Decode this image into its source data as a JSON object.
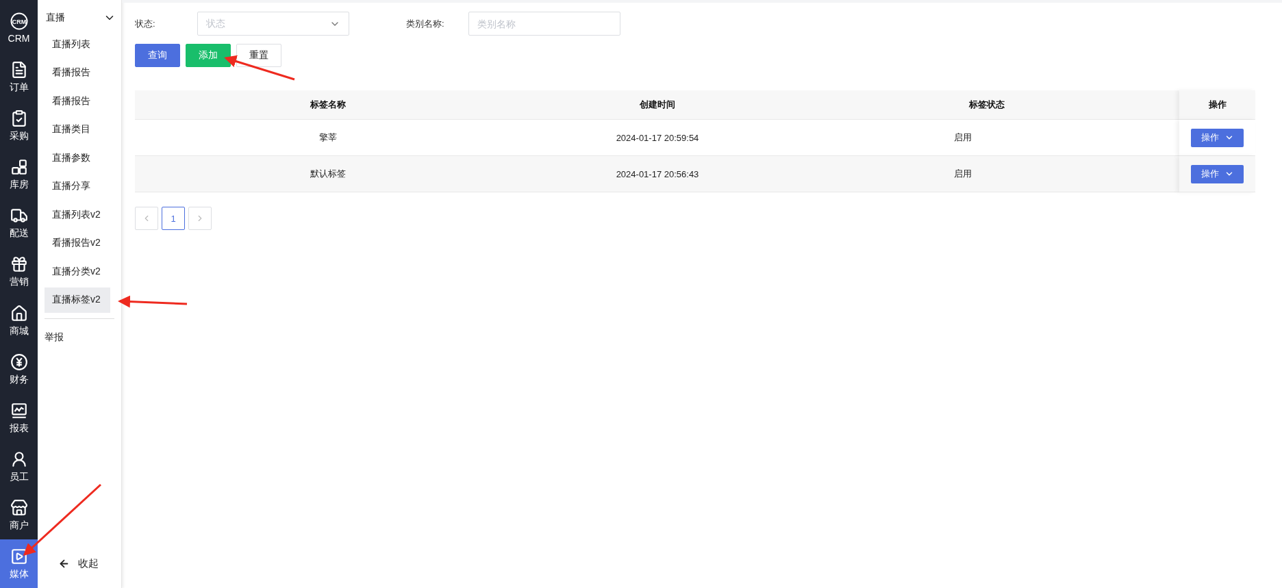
{
  "nav_rail": {
    "items": [
      {
        "label": "CRM",
        "icon_text": "CRM",
        "selected": false
      },
      {
        "label": "订单",
        "selected": false
      },
      {
        "label": "采购",
        "selected": false
      },
      {
        "label": "库房",
        "selected": false
      },
      {
        "label": "配送",
        "selected": false
      },
      {
        "label": "营销",
        "selected": false
      },
      {
        "label": "商城",
        "selected": false
      },
      {
        "label": "财务",
        "selected": false
      },
      {
        "label": "报表",
        "selected": false
      },
      {
        "label": "员工",
        "selected": false
      },
      {
        "label": "商户",
        "selected": false
      },
      {
        "label": "媒体",
        "selected": true
      }
    ]
  },
  "submenu": {
    "group": {
      "label": "直播",
      "expanded": true,
      "children": [
        {
          "label": "直播列表",
          "selected": false
        },
        {
          "label": "看播报告",
          "selected": false
        },
        {
          "label": "看播报告",
          "selected": false
        },
        {
          "label": "直播类目",
          "selected": false
        },
        {
          "label": "直播参数",
          "selected": false
        },
        {
          "label": "直播分享",
          "selected": false
        },
        {
          "label": "直播列表v2",
          "selected": false
        },
        {
          "label": "看播报告v2",
          "selected": false
        },
        {
          "label": "直播分类v2",
          "selected": false
        },
        {
          "label": "直播标签v2",
          "selected": true
        }
      ]
    },
    "items": [
      {
        "label": "举报"
      }
    ],
    "collapse": "收起"
  },
  "filters": [
    {
      "label": "状态:",
      "placeholder": "状态",
      "kind": "select"
    },
    {
      "label": "类别名称:",
      "placeholder": "类别名称",
      "kind": "input"
    }
  ],
  "buttons": [
    {
      "label": "查询",
      "kind": "primary"
    },
    {
      "label": "添加",
      "kind": "success"
    },
    {
      "label": "重置",
      "kind": "default"
    }
  ],
  "table": {
    "columns": [
      "标签名称",
      "创建时间",
      "标签状态",
      "操作"
    ],
    "rows": [
      {
        "cells": [
          "擎莘",
          "2024-01-17 20:59:54",
          "启用"
        ],
        "action": "操作"
      },
      {
        "cells": [
          "默认标签",
          "2024-01-17 20:56:43",
          "启用"
        ],
        "action": "操作"
      }
    ]
  },
  "pagination": {
    "pages": [
      {
        "label": "1",
        "selected": true
      }
    ]
  }
}
